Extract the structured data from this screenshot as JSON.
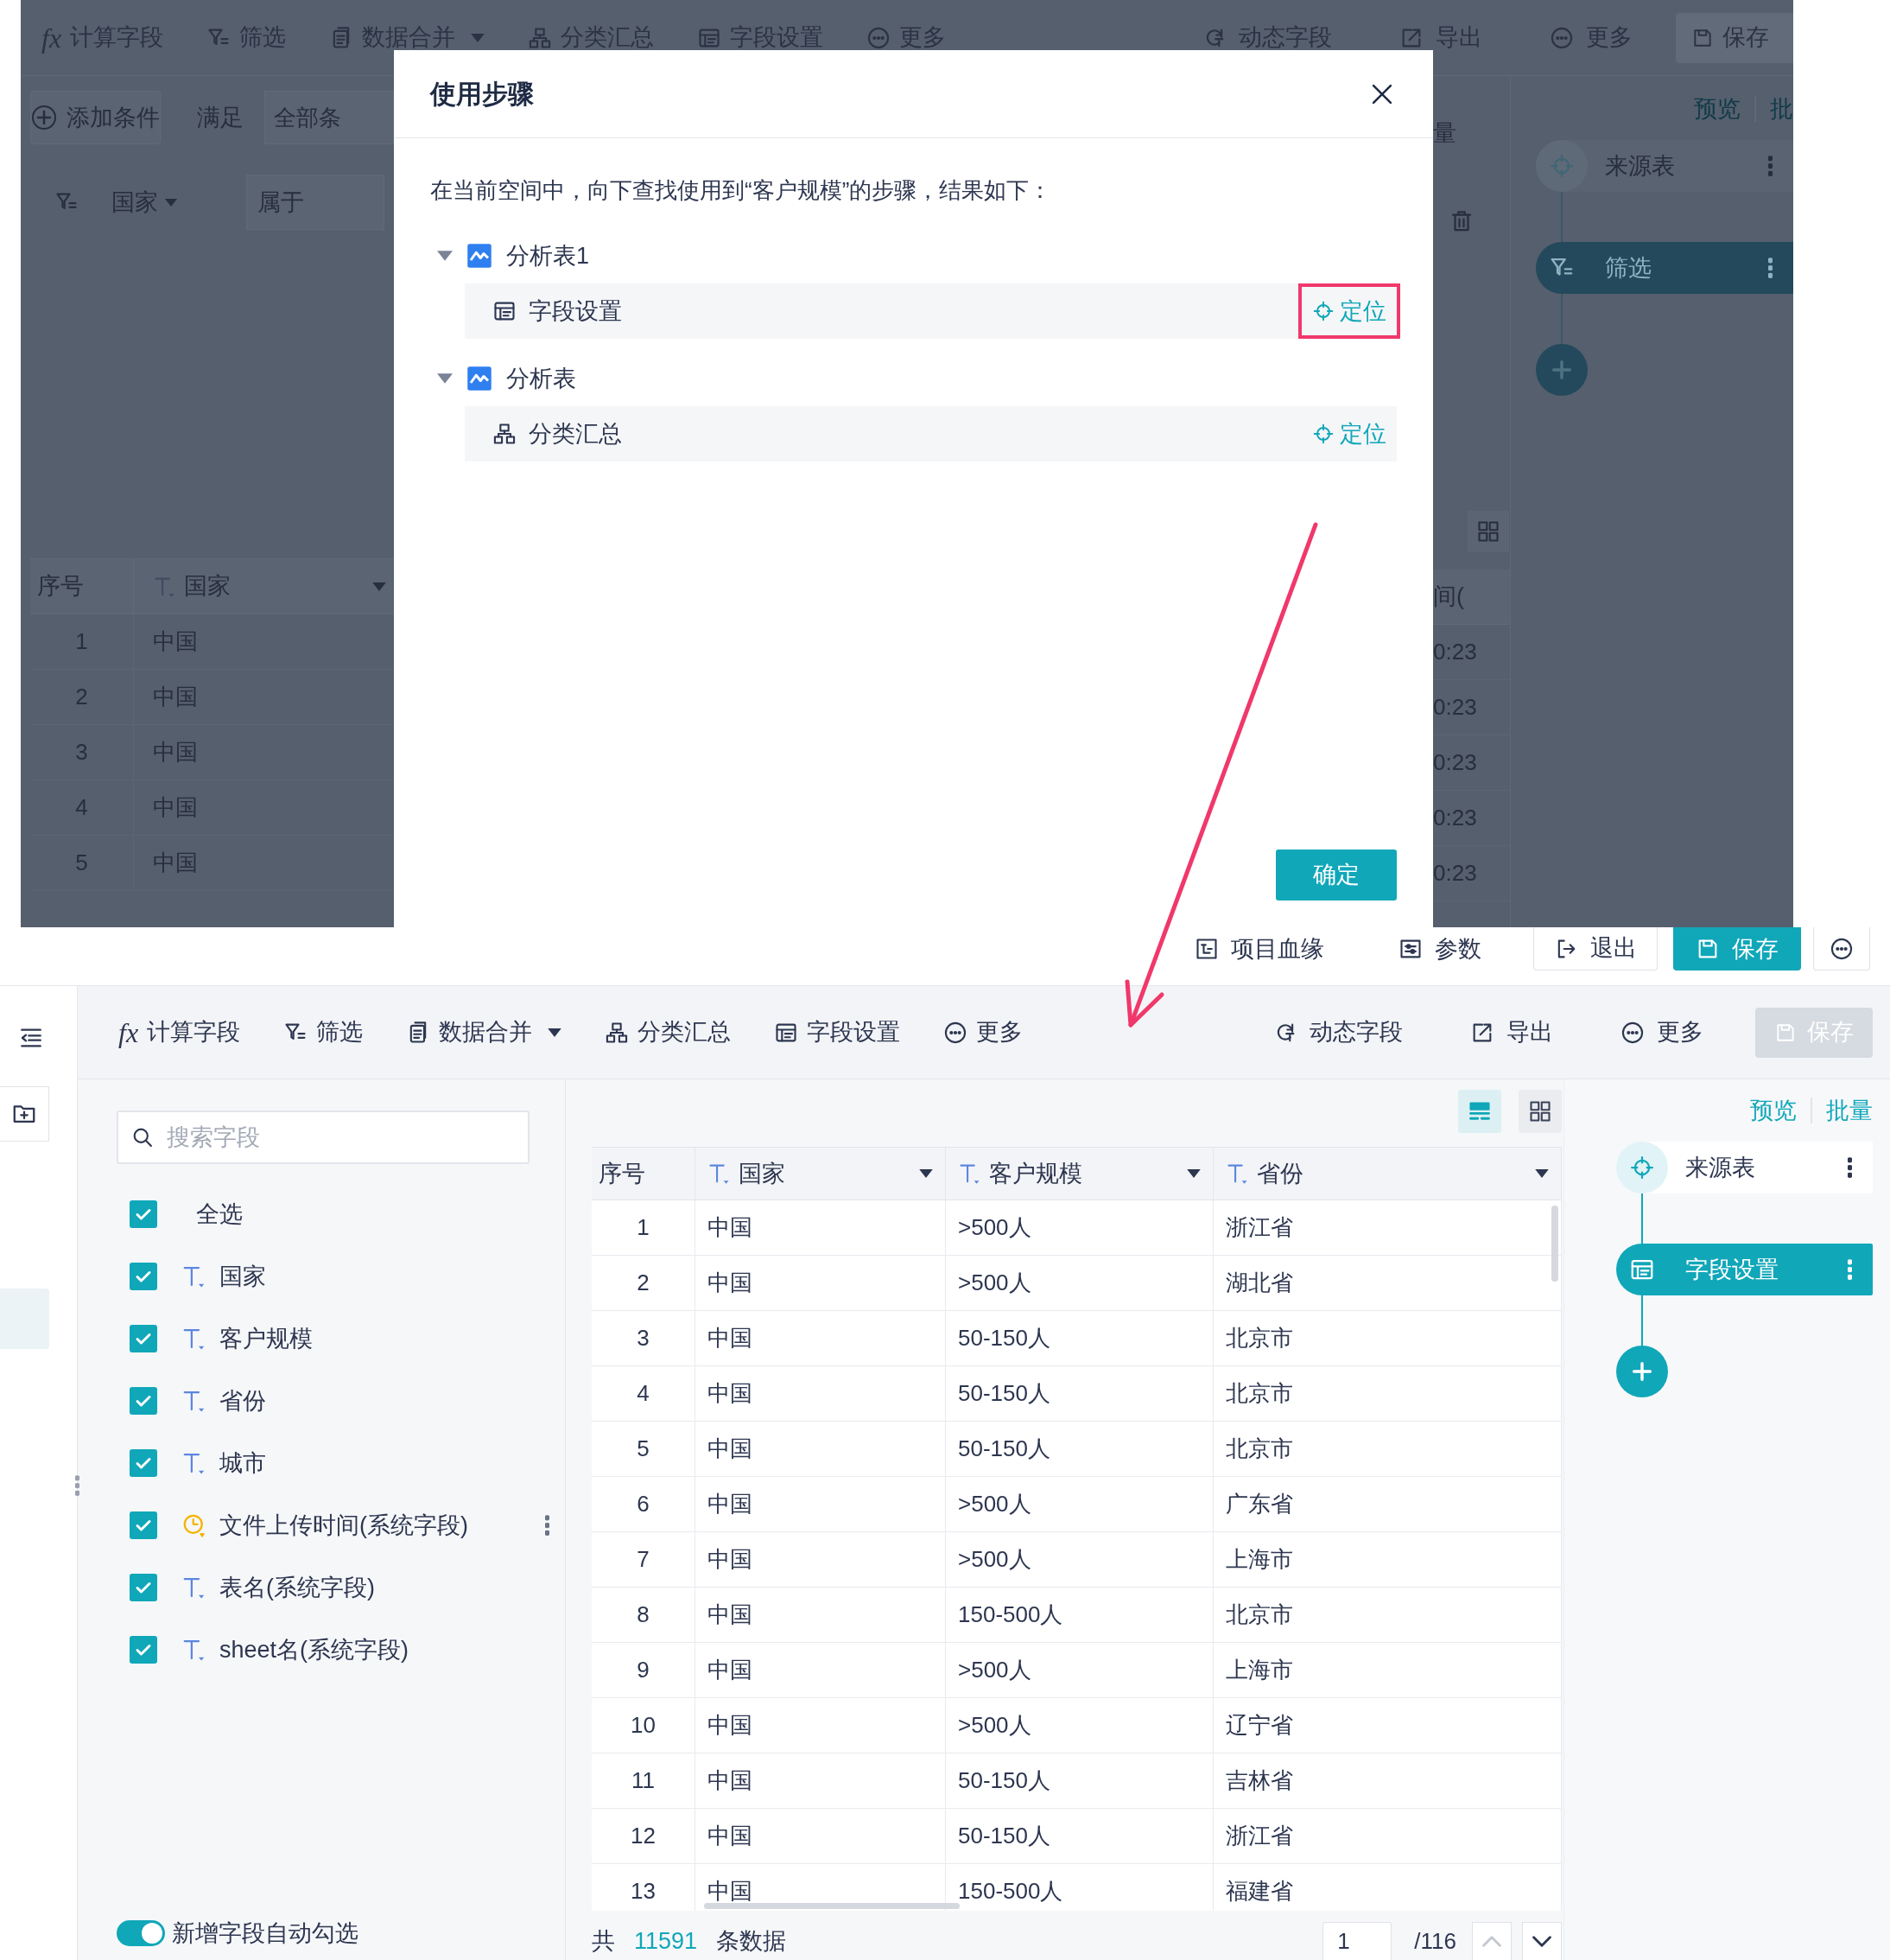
{
  "background": {
    "toolbar": {
      "left": [
        {
          "kind": "formula",
          "glyph": "fx",
          "label": "计算字段",
          "dropdown": false
        },
        {
          "kind": "filter",
          "label": "筛选",
          "dropdown": false
        },
        {
          "kind": "merge",
          "label": "数据合并",
          "dropdown": true
        },
        {
          "kind": "summary",
          "label": "分类汇总",
          "dropdown": false
        },
        {
          "kind": "fields",
          "label": "字段设置",
          "dropdown": false
        },
        {
          "kind": "more",
          "label": "更多",
          "dropdown": false
        }
      ],
      "right": [
        {
          "kind": "dynamic",
          "label": "动态字段"
        },
        {
          "kind": "export",
          "label": "导出"
        },
        {
          "kind": "more",
          "label": "更多"
        }
      ],
      "save": {
        "label": "保存",
        "disabled": true
      }
    },
    "condition_bar": {
      "add_button": "添加条件",
      "match_label": "满足",
      "match_field": "全部条",
      "cut_label": "量"
    },
    "condition": {
      "field": "国家",
      "operator": "属于"
    },
    "table": {
      "columns": [
        {
          "label": "序号",
          "kind": "index"
        },
        {
          "label": "国家",
          "kind": "text"
        },
        {
          "label": "间(",
          "kind": "plain"
        }
      ],
      "rows": [
        [
          "1",
          "中国",
          "0:23"
        ],
        [
          "2",
          "中国",
          "0:23"
        ],
        [
          "3",
          "中国",
          "0:23"
        ],
        [
          "4",
          "中国",
          "0:23"
        ],
        [
          "5",
          "中国",
          "0:23"
        ]
      ]
    },
    "flow": {
      "links": [
        "预览",
        "批"
      ],
      "nodes": [
        {
          "label": "来源表",
          "kind": "source",
          "selected": false
        },
        {
          "label": "筛选",
          "kind": "filter",
          "selected": true
        }
      ]
    }
  },
  "dialog": {
    "title": "使用步骤",
    "description": "在当前空间中，向下查找使用到“客户规模”的步骤，结果如下：",
    "groups": [
      {
        "label": "分析表1",
        "expanded": true,
        "steps": [
          {
            "label": "字段设置",
            "kind": "fields",
            "action": "定位",
            "highlighted": true
          }
        ]
      },
      {
        "label": "分析表",
        "expanded": true,
        "steps": [
          {
            "label": "分类汇总",
            "kind": "summary",
            "action": "定位",
            "highlighted": false
          }
        ]
      }
    ],
    "confirm": "确定"
  },
  "project_bar": {
    "lineage": "项目血缘",
    "params": "参数",
    "exit": "退出",
    "save": "保存"
  },
  "editor": {
    "toolbar": {
      "left": [
        {
          "kind": "formula",
          "glyph": "fx",
          "label": "计算字段",
          "dropdown": false
        },
        {
          "kind": "filter",
          "label": "筛选",
          "dropdown": false
        },
        {
          "kind": "merge",
          "label": "数据合并",
          "dropdown": true
        },
        {
          "kind": "summary",
          "label": "分类汇总",
          "dropdown": false
        },
        {
          "kind": "fields",
          "label": "字段设置",
          "dropdown": false
        },
        {
          "kind": "more",
          "label": "更多",
          "dropdown": false
        }
      ],
      "right": [
        {
          "kind": "dynamic",
          "label": "动态字段"
        },
        {
          "kind": "export",
          "label": "导出"
        },
        {
          "kind": "more",
          "label": "更多"
        }
      ],
      "save": {
        "label": "保存",
        "disabled": true
      }
    },
    "search": {
      "placeholder": "搜索字段"
    },
    "select_all": {
      "label": "全选",
      "checked": true
    },
    "fields": [
      {
        "label": "国家",
        "kind": "text",
        "checked": true,
        "hovered": false
      },
      {
        "label": "客户规模",
        "kind": "text",
        "checked": true,
        "hovered": false
      },
      {
        "label": "省份",
        "kind": "text",
        "checked": true,
        "hovered": false
      },
      {
        "label": "城市",
        "kind": "text",
        "checked": true,
        "hovered": false
      },
      {
        "label": "文件上传时间(系统字段)",
        "kind": "time",
        "checked": true,
        "hovered": true
      },
      {
        "label": "表名(系统字段)",
        "kind": "text",
        "checked": true,
        "hovered": false
      },
      {
        "label": "sheet名(系统字段)",
        "kind": "text",
        "checked": true,
        "hovered": false
      }
    ],
    "auto_check": {
      "label": "新增字段自动勾选",
      "on": true
    },
    "views": [
      {
        "kind": "list",
        "selected": true
      },
      {
        "kind": "grid",
        "selected": false
      }
    ],
    "table": {
      "columns": [
        {
          "label": "序号",
          "kind": "index"
        },
        {
          "label": "国家",
          "kind": "text"
        },
        {
          "label": "客户规模",
          "kind": "text"
        },
        {
          "label": "省份",
          "kind": "text"
        }
      ],
      "rows": [
        [
          "1",
          "中国",
          ">500人",
          "浙江省"
        ],
        [
          "2",
          "中国",
          ">500人",
          "湖北省"
        ],
        [
          "3",
          "中国",
          "50-150人",
          "北京市"
        ],
        [
          "4",
          "中国",
          "50-150人",
          "北京市"
        ],
        [
          "5",
          "中国",
          "50-150人",
          "北京市"
        ],
        [
          "6",
          "中国",
          ">500人",
          "广东省"
        ],
        [
          "7",
          "中国",
          ">500人",
          "上海市"
        ],
        [
          "8",
          "中国",
          "150-500人",
          "北京市"
        ],
        [
          "9",
          "中国",
          ">500人",
          "上海市"
        ],
        [
          "10",
          "中国",
          ">500人",
          "辽宁省"
        ],
        [
          "11",
          "中国",
          "50-150人",
          "吉林省"
        ],
        [
          "12",
          "中国",
          "50-150人",
          "浙江省"
        ],
        [
          "13",
          "中国",
          "150-500人",
          "福建省"
        ]
      ]
    },
    "footer": {
      "prefix": "共",
      "count": "11591",
      "suffix": "条数据",
      "page": "1",
      "pages": "/116"
    },
    "flow": {
      "links": [
        "预览",
        "批量"
      ],
      "nodes": [
        {
          "label": "来源表",
          "kind": "source",
          "selected": false
        },
        {
          "label": "字段设置",
          "kind": "fields",
          "selected": true
        }
      ]
    }
  }
}
